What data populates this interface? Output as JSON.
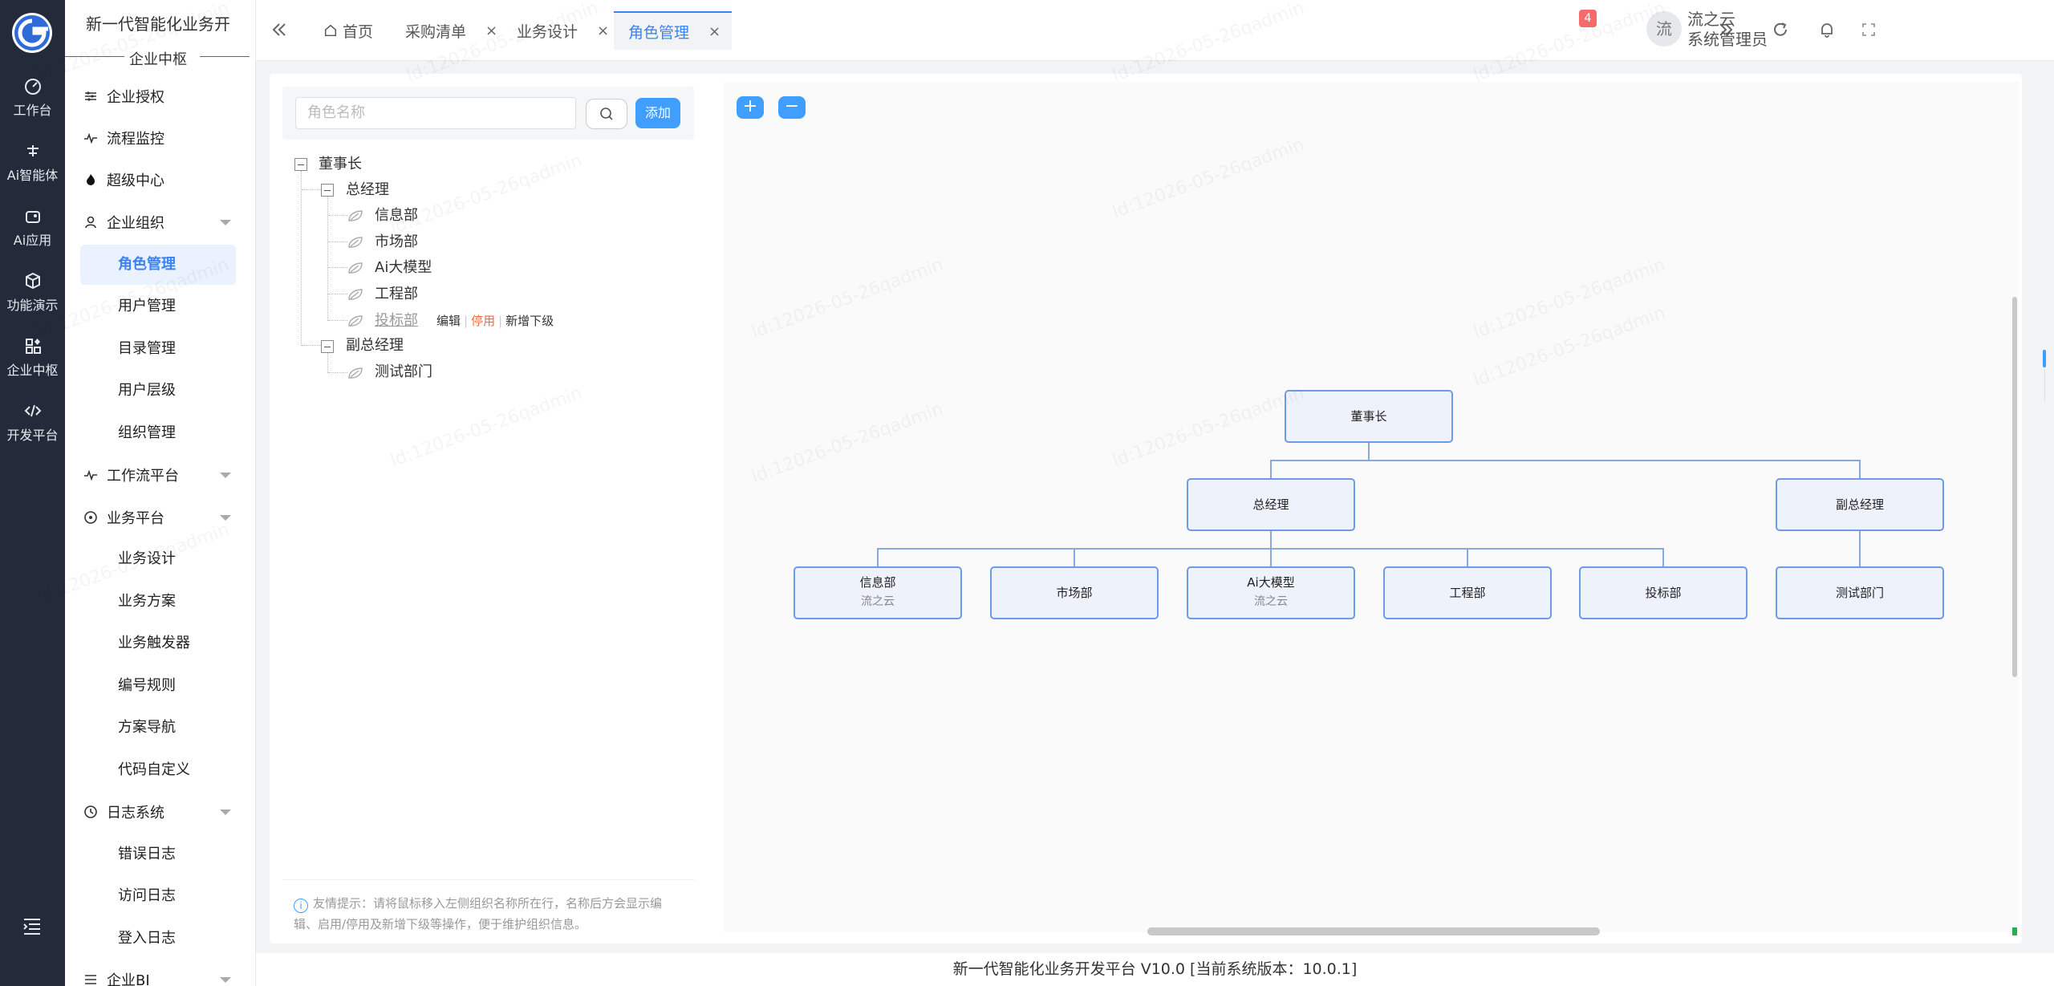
{
  "rail": {
    "items": [
      {
        "label": "工作台",
        "icon": "dashboard-icon"
      },
      {
        "label": "Ai智能体",
        "icon": "ai-agent-icon"
      },
      {
        "label": "Ai应用",
        "icon": "ai-app-icon"
      },
      {
        "label": "功能演示",
        "icon": "cube-icon"
      },
      {
        "label": "企业中枢",
        "icon": "grid-icon"
      },
      {
        "label": "开发平台",
        "icon": "code-icon"
      }
    ]
  },
  "menu": {
    "app_title": "新一代智能化业务开",
    "section": "企业中枢",
    "groups": [
      {
        "label": "企业授权"
      },
      {
        "label": "流程监控"
      },
      {
        "label": "超级中心"
      },
      {
        "label": "企业组织"
      },
      {
        "label": "工作流平台"
      },
      {
        "label": "业务平台"
      },
      {
        "label": "日志系统"
      },
      {
        "label": "企业BI"
      }
    ],
    "org_sub": [
      "角色管理",
      "用户管理",
      "目录管理",
      "用户层级",
      "组织管理"
    ],
    "biz_sub": [
      "业务设计",
      "业务方案",
      "业务触发器",
      "编号规则",
      "方案导航",
      "代码自定义"
    ],
    "log_sub": [
      "错误日志",
      "访问日志",
      "登入日志"
    ]
  },
  "header": {
    "tabs": [
      "首页",
      "采购清单",
      "业务设计",
      "角色管理"
    ],
    "notification_count": "4",
    "avatar_text": "流",
    "user_name": "流之云",
    "user_role": "系统管理员"
  },
  "panel": {
    "search_placeholder": "角色名称",
    "add_label": "添加",
    "tree": {
      "root": "董事长",
      "gm": "总经理",
      "gm_children": [
        "信息部",
        "市场部",
        "Ai大模型",
        "工程部",
        "投标部"
      ],
      "vgm": "副总经理",
      "vgm_children": [
        "测试部门"
      ]
    },
    "actions": {
      "edit": "编辑",
      "disable": "停用",
      "add_child": "新增下级"
    },
    "tip": "友情提示：请将鼠标移入左侧组织名称所在行，名称后方会显示编辑、启用/停用及新增下级等操作，便于维护组织信息。"
  },
  "orgchart": {
    "zoom_in": "+",
    "zoom_out": "−",
    "root": {
      "title": "董事长"
    },
    "level2": [
      {
        "title": "总经理"
      },
      {
        "title": "副总经理"
      }
    ],
    "level3": [
      {
        "title": "信息部",
        "sub": "流之云"
      },
      {
        "title": "市场部",
        "sub": ""
      },
      {
        "title": "Ai大模型",
        "sub": "流之云"
      },
      {
        "title": "工程部",
        "sub": ""
      },
      {
        "title": "投标部",
        "sub": ""
      },
      {
        "title": "测试部门",
        "sub": ""
      }
    ]
  },
  "watermark": "ld:12026-05-26qadmin",
  "footer": "新一代智能化业务开发平台 V10.0 [当前系统版本：10.0.1]",
  "colors": {
    "accent": "#409eff",
    "rail_bg": "#232a39",
    "warn": "#f06a3c",
    "node_border": "#6f9be6"
  }
}
